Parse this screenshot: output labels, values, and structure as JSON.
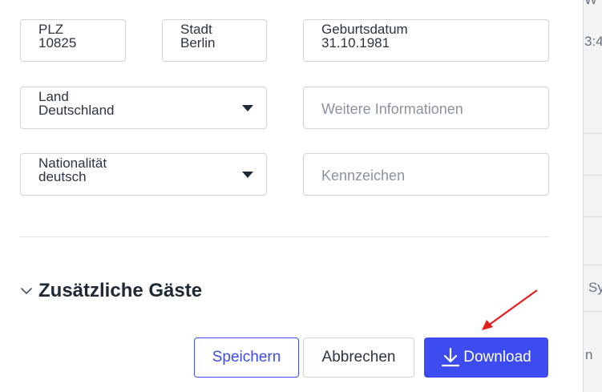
{
  "form": {
    "plz": {
      "label": "PLZ",
      "value": "10825"
    },
    "stadt": {
      "label": "Stadt",
      "value": "Berlin"
    },
    "geburtsdatum": {
      "label": "Geburtsdatum",
      "value": "31.10.1981"
    },
    "land": {
      "label": "Land",
      "value": "Deutschland"
    },
    "weitere": {
      "placeholder": "Weitere Informationen"
    },
    "nationalitaet": {
      "label": "Nationalität",
      "value": "deutsch"
    },
    "kennzeichen": {
      "placeholder": "Kennzeichen"
    }
  },
  "section": {
    "title": "Zusätzliche Gäste",
    "icon": "chevron-down-icon"
  },
  "buttons": {
    "save": "Speichern",
    "cancel": "Abbrechen",
    "download": "Download",
    "download_icon": "download-icon"
  },
  "backdrop": {
    "fragments": [
      "3:4",
      "Sy",
      "n",
      "W"
    ]
  },
  "colors": {
    "accent": "#3d4cf0",
    "annotation_arrow": "#e3201b"
  }
}
